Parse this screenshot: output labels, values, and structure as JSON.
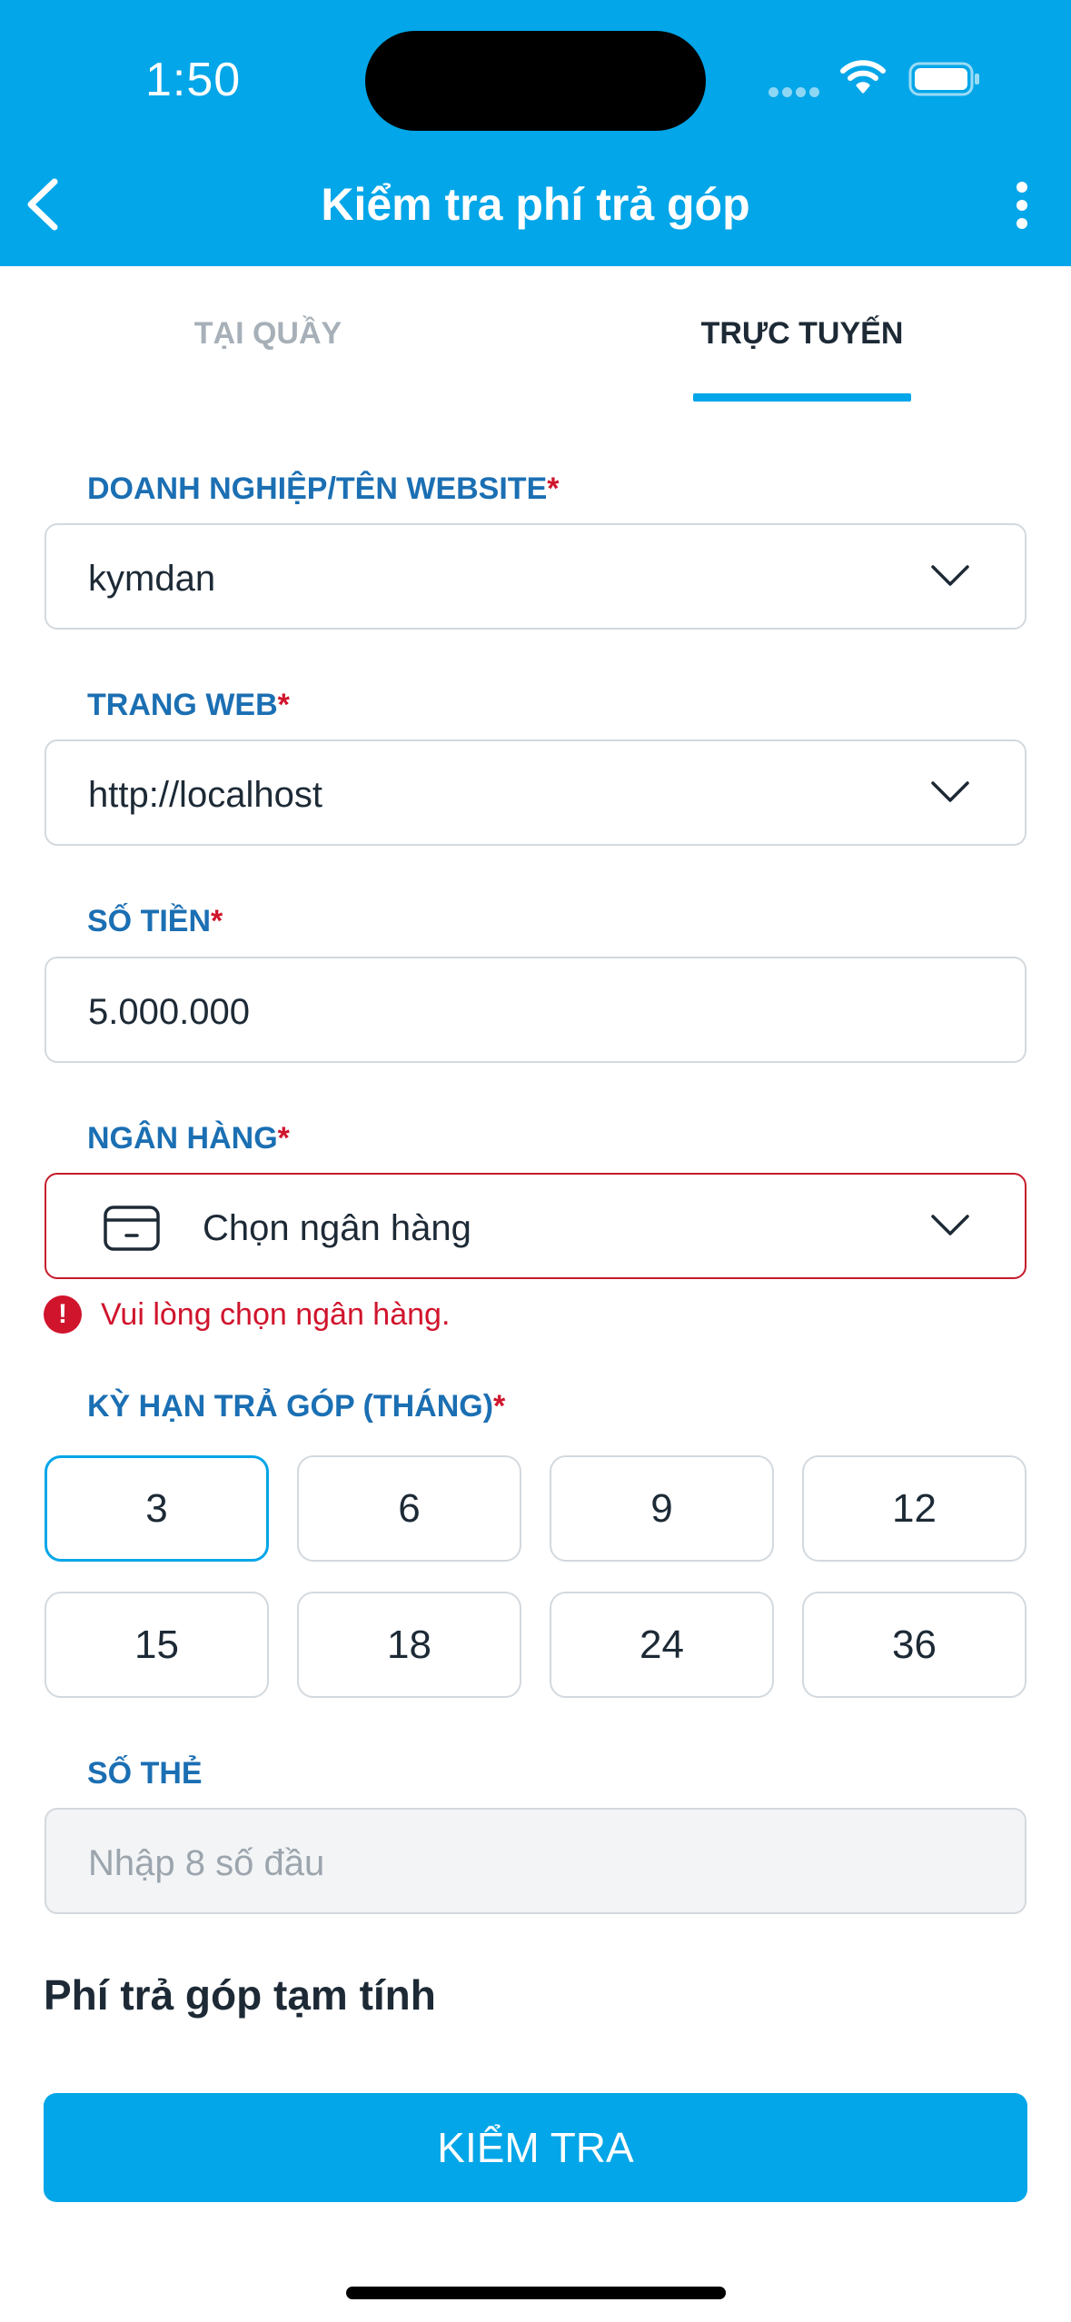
{
  "status_bar": {
    "time": "1:50"
  },
  "nav": {
    "title": "Kiểm tra phí trả góp"
  },
  "tabs": [
    {
      "label": "TẠI QUẦY",
      "active": false
    },
    {
      "label": "TRỰC TUYẾN",
      "active": true
    }
  ],
  "form": {
    "business": {
      "label": "DOANH NGHIỆP/TÊN WEBSITE",
      "required": "*",
      "value": "kymdan"
    },
    "website": {
      "label": "TRANG WEB",
      "required": "*",
      "value": "http://localhost"
    },
    "amount": {
      "label": "SỐ TIỀN",
      "required": "*",
      "value": "5.000.000"
    },
    "bank": {
      "label": "NGÂN HÀNG",
      "required": "*",
      "placeholder": "Chọn ngân hàng",
      "error_icon": "!",
      "error": "Vui lòng chọn ngân hàng."
    },
    "term": {
      "label": "KỲ HẠN TRẢ GÓP (THÁNG)",
      "required": "*",
      "options": [
        "3",
        "6",
        "9",
        "12",
        "15",
        "18",
        "24",
        "36"
      ],
      "selected": "3"
    },
    "card": {
      "label": "SỐ THẺ",
      "placeholder": "Nhập 8 số đầu"
    }
  },
  "estimate": {
    "title": "Phí trả góp tạm tính"
  },
  "actions": {
    "check_label": "KIỂM TRA"
  },
  "colors": {
    "primary": "#03a6e8",
    "label": "#1b6fb3",
    "error": "#d0142c",
    "border": "#d3d9de"
  }
}
